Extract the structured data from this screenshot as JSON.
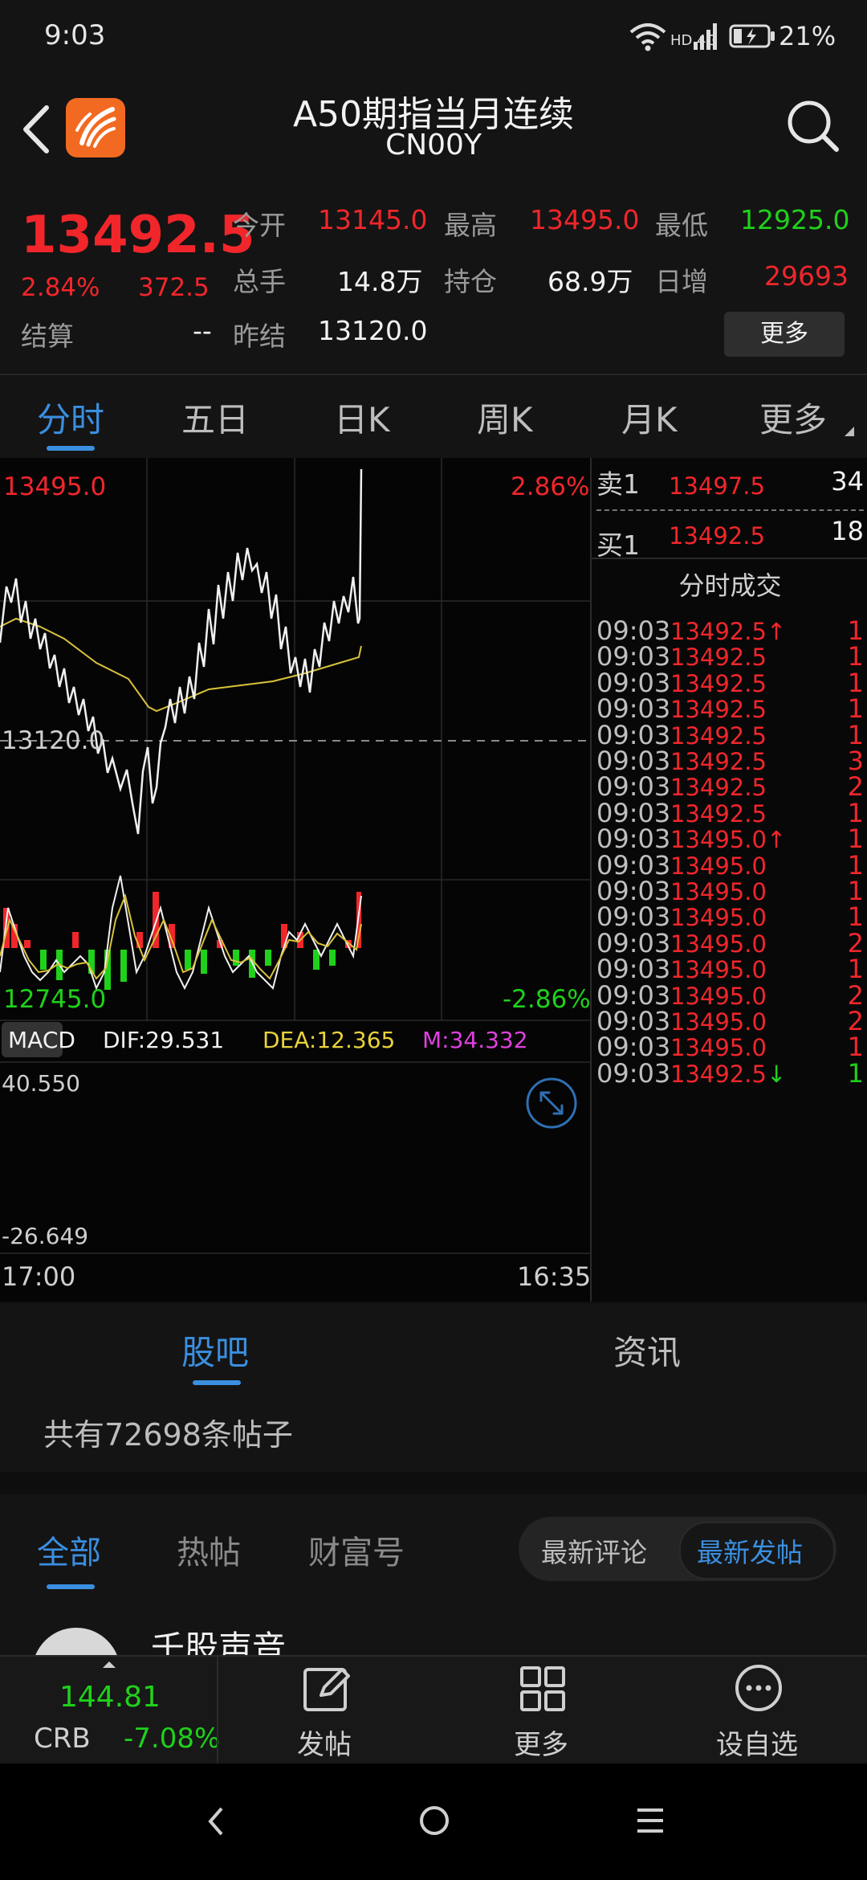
{
  "status_bar": {
    "time": "9:03",
    "network": "HD 4G",
    "battery": "21%"
  },
  "header": {
    "title": "A50期指当月连续",
    "code": "CN00Y"
  },
  "quote": {
    "price": "13492.5",
    "change_pct": "2.84%",
    "change": "372.5",
    "settle_label": "结算",
    "settle_value": "--",
    "fields": [
      {
        "label": "今开",
        "value": "13145.0",
        "color": "red"
      },
      {
        "label": "最高",
        "value": "13495.0",
        "color": "red"
      },
      {
        "label": "最低",
        "value": "12925.0",
        "color": "green"
      },
      {
        "label": "总手",
        "value": "14.8万",
        "color": "white"
      },
      {
        "label": "持仓",
        "value": "68.9万",
        "color": "white"
      },
      {
        "label": "日增",
        "value": "29693",
        "color": "red"
      },
      {
        "label": "昨结",
        "value": "13120.0",
        "color": "white"
      }
    ],
    "more_button": "更多"
  },
  "tabs": [
    "分时",
    "五日",
    "日K",
    "周K",
    "月K",
    "更多"
  ],
  "chart": {
    "top_price": "13495.0",
    "top_pct": "2.86%",
    "mid_price": "13120.0",
    "bottom_price": "12745.0",
    "bottom_pct": "-2.86%",
    "time_start": "17:00",
    "time_end": "16:35"
  },
  "macd": {
    "label": "MACD",
    "dif": "DIF:29.531",
    "dea": "DEA:12.365",
    "m": "M:34.332",
    "max": "40.550",
    "min": "-26.649"
  },
  "order_book": {
    "sell_label": "卖1",
    "sell_price": "13497.5",
    "sell_vol": "34",
    "buy_label": "买1",
    "buy_price": "13492.5",
    "buy_vol": "18",
    "trades_title": "分时成交",
    "trades": [
      {
        "time": "09:03",
        "price": "13492.5↑",
        "vol": "1",
        "dir": "up"
      },
      {
        "time": "09:03",
        "price": "13492.5",
        "vol": "1",
        "dir": "up"
      },
      {
        "time": "09:03",
        "price": "13492.5",
        "vol": "1",
        "dir": "up"
      },
      {
        "time": "09:03",
        "price": "13492.5",
        "vol": "1",
        "dir": "up"
      },
      {
        "time": "09:03",
        "price": "13492.5",
        "vol": "1",
        "dir": "up"
      },
      {
        "time": "09:03",
        "price": "13492.5",
        "vol": "3",
        "dir": "up"
      },
      {
        "time": "09:03",
        "price": "13492.5",
        "vol": "2",
        "dir": "up"
      },
      {
        "time": "09:03",
        "price": "13492.5",
        "vol": "1",
        "dir": "up"
      },
      {
        "time": "09:03",
        "price": "13495.0↑",
        "vol": "1",
        "dir": "up"
      },
      {
        "time": "09:03",
        "price": "13495.0",
        "vol": "1",
        "dir": "up"
      },
      {
        "time": "09:03",
        "price": "13495.0",
        "vol": "1",
        "dir": "up"
      },
      {
        "time": "09:03",
        "price": "13495.0",
        "vol": "1",
        "dir": "up"
      },
      {
        "time": "09:03",
        "price": "13495.0",
        "vol": "2",
        "dir": "up"
      },
      {
        "time": "09:03",
        "price": "13495.0",
        "vol": "1",
        "dir": "up"
      },
      {
        "time": "09:03",
        "price": "13495.0",
        "vol": "2",
        "dir": "up"
      },
      {
        "time": "09:03",
        "price": "13495.0",
        "vol": "2",
        "dir": "up"
      },
      {
        "time": "09:03",
        "price": "13495.0",
        "vol": "1",
        "dir": "up"
      },
      {
        "time": "09:03",
        "price": "13492.5↓",
        "vol": "1",
        "dir": "down"
      }
    ]
  },
  "section_tabs": [
    "股吧",
    "资讯"
  ],
  "posts_count": "共有72698条帖子",
  "filter_tabs": [
    "全部",
    "热帖",
    "财富号"
  ],
  "sort_options": [
    "最新评论",
    "最新发帖"
  ],
  "user_partial": "千股声音",
  "bottom_bar": {
    "crb_value": "144.81",
    "crb_label": "CRB",
    "crb_change": "-7.08%",
    "post_label": "发帖",
    "more_label": "更多",
    "watch_label": "设自选"
  }
}
